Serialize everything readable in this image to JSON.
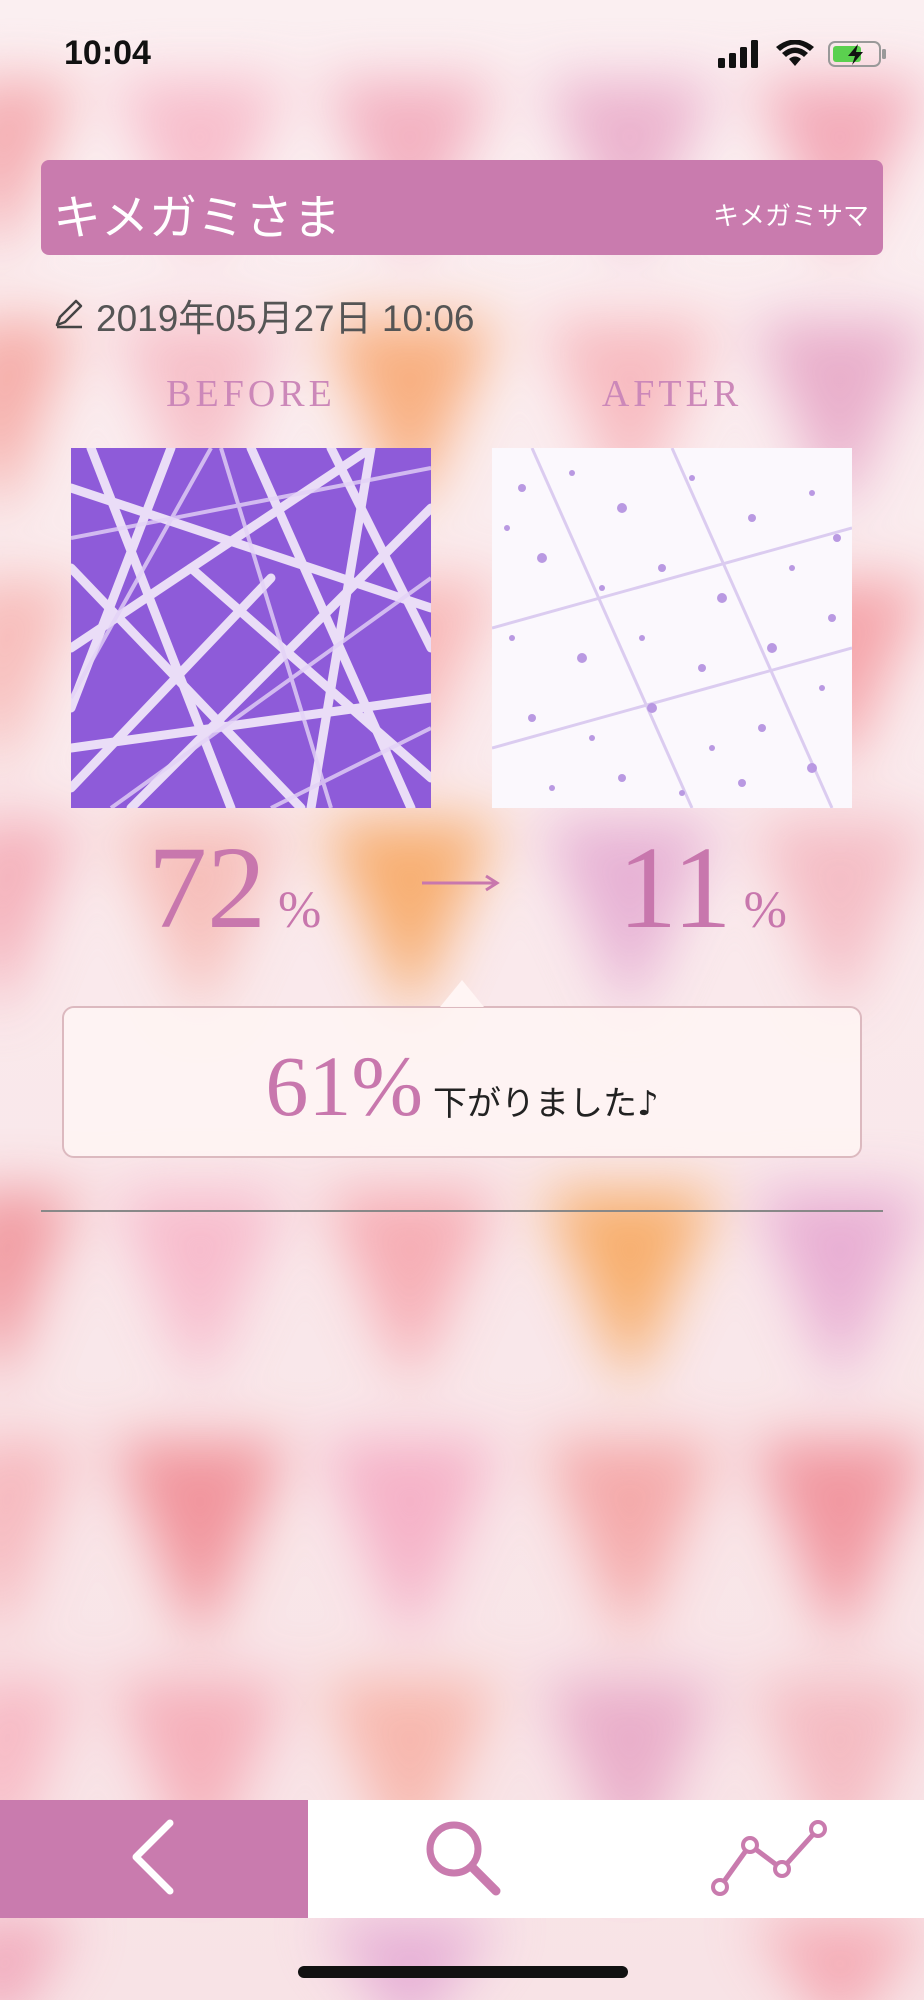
{
  "status": {
    "time": "10:04",
    "icons": [
      "signal-icon",
      "wifi-icon",
      "battery-charging-icon"
    ]
  },
  "header": {
    "title": "キメガミさま",
    "reading": "キメガミサマ",
    "color": "#c97bae"
  },
  "record": {
    "date": "2019年05月27日 10:06",
    "icon": "pencil-icon"
  },
  "comparison": {
    "before_label": "BEFORE",
    "after_label": "AFTER",
    "before_value": "72",
    "after_value": "11",
    "unit": "%",
    "arrow": "→"
  },
  "result": {
    "value": "61%",
    "text": "下がりました♪"
  },
  "tabbar": {
    "tabs": [
      {
        "name": "back",
        "icon": "chevron-left-icon",
        "active": true
      },
      {
        "name": "search",
        "icon": "search-icon",
        "active": false
      },
      {
        "name": "graph",
        "icon": "line-chart-icon",
        "active": false
      }
    ],
    "accent": "#c97bae"
  }
}
